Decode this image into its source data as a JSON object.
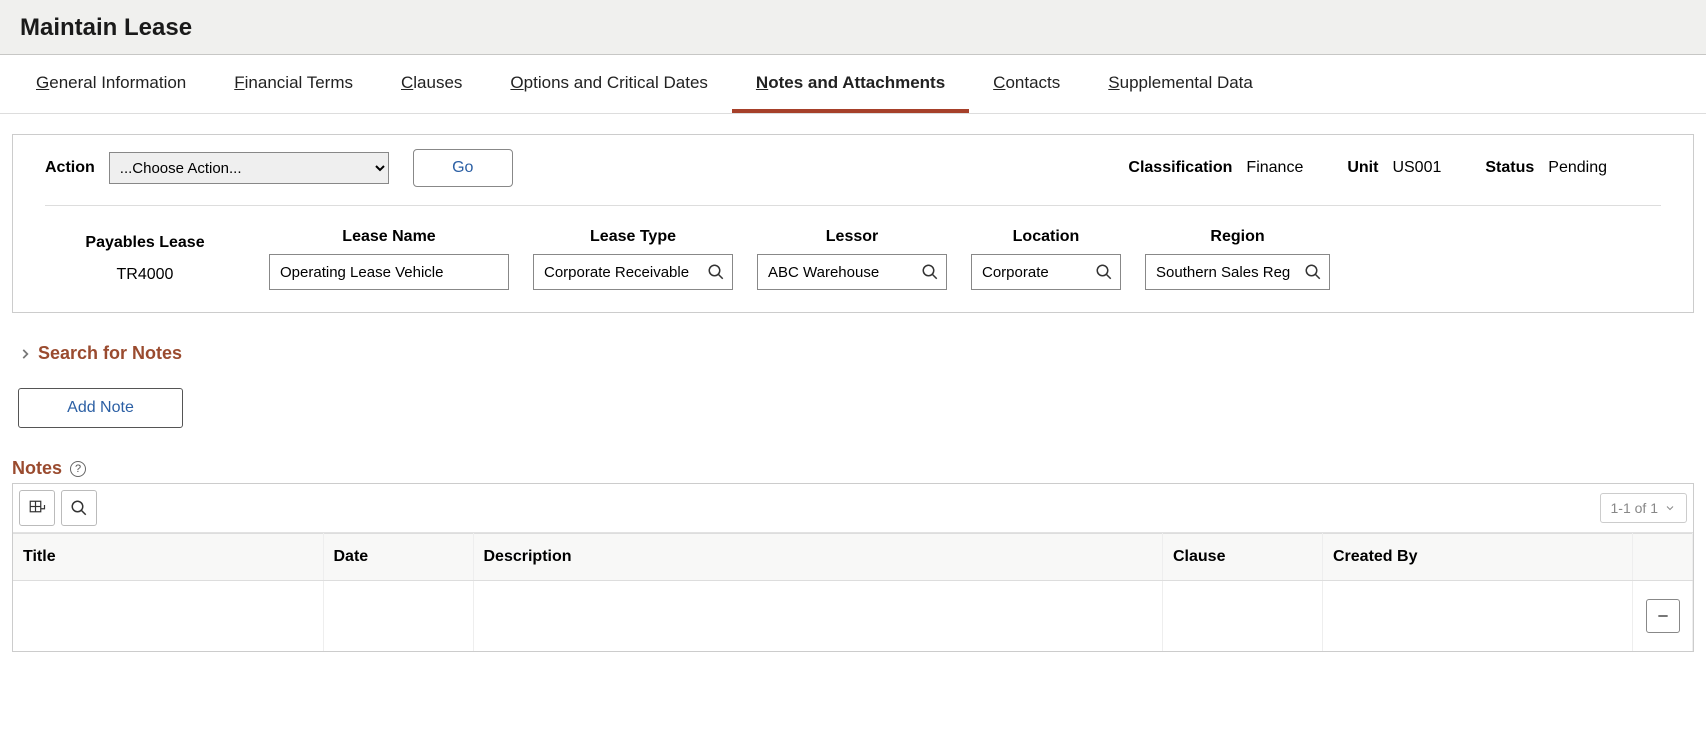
{
  "header": {
    "title": "Maintain Lease"
  },
  "tabs": [
    {
      "accesskey": "G",
      "rest": "eneral Information",
      "active": false
    },
    {
      "accesskey": "F",
      "rest": "inancial Terms",
      "active": false
    },
    {
      "accesskey": "C",
      "rest": "lauses",
      "active": false
    },
    {
      "accesskey": "O",
      "rest": "ptions and Critical Dates",
      "active": false
    },
    {
      "accesskey": "N",
      "rest": "otes and Attachments",
      "active": true
    },
    {
      "accesskey": "C",
      "rest": "ontacts",
      "active": false
    },
    {
      "accesskey": "S",
      "rest": "upplemental Data",
      "active": false
    }
  ],
  "action_bar": {
    "action_label": "Action",
    "action_selected": "...Choose Action...",
    "go_label": "Go",
    "classification_label": "Classification",
    "classification_value": "Finance",
    "unit_label": "Unit",
    "unit_value": "US001",
    "status_label": "Status",
    "status_value": "Pending"
  },
  "lease_fields": {
    "payables_label": "Payables Lease",
    "payables_value": "TR4000",
    "lease_name_label": "Lease Name",
    "lease_name_value": "Operating Lease Vehicle",
    "lease_type_label": "Lease Type",
    "lease_type_value": "Corporate Receivable",
    "lessor_label": "Lessor",
    "lessor_value": "ABC Warehouse",
    "location_label": "Location",
    "location_value": "Corporate",
    "region_label": "Region",
    "region_value": "Southern Sales Reg"
  },
  "search_section": {
    "label": "Search for Notes"
  },
  "add_note": {
    "label": "Add Note"
  },
  "notes_section": {
    "heading": "Notes",
    "pager_text": "1-1 of 1",
    "columns": {
      "title": "Title",
      "date": "Date",
      "description": "Description",
      "clause": "Clause",
      "created_by": "Created By"
    },
    "rows": [
      {
        "title": "",
        "date": "",
        "description": "",
        "clause": "",
        "created_by": ""
      }
    ]
  }
}
